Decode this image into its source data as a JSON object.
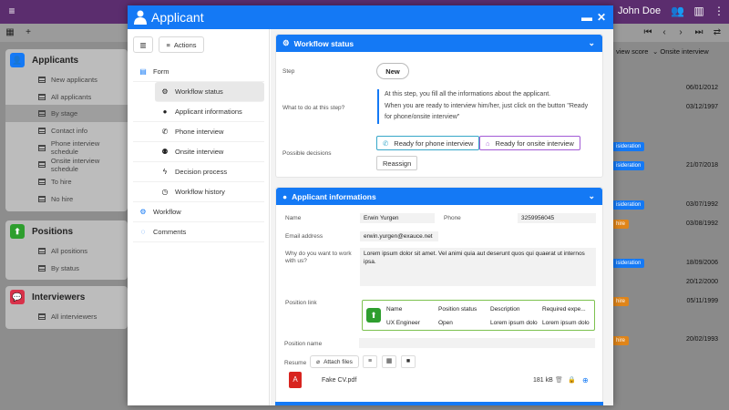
{
  "topbar": {
    "user_name": "John Doe"
  },
  "nav": {
    "applicants": {
      "title": "Applicants",
      "items": [
        "New applicants",
        "All applicants",
        "By stage",
        "Contact info",
        "Phone interview schedule",
        "Onsite interview schedule",
        "To hire",
        "No hire"
      ],
      "selected": "By stage"
    },
    "positions": {
      "title": "Positions",
      "items": [
        "All positions",
        "By status"
      ]
    },
    "interviewers": {
      "title": "Interviewers",
      "items": [
        "All interviewers"
      ]
    }
  },
  "background_list": {
    "columns": [
      "view score",
      "Onsite interview"
    ],
    "dates": [
      "06/01/2012",
      "03/12/1997",
      "21/07/2018",
      "03/07/1992",
      "03/08/1992",
      "18/09/2006",
      "20/12/2000",
      "05/11/1999",
      "20/02/1993"
    ],
    "badges": [
      "isideration",
      "isideration",
      "isideration",
      "hire",
      "isideration",
      "hire",
      "hire"
    ]
  },
  "modal": {
    "title": "Applicant",
    "actions_label": "Actions",
    "tree": [
      {
        "label": "Form",
        "icon": "form-icon",
        "level": 0
      },
      {
        "label": "Workflow status",
        "icon": "gear-icon",
        "level": 1,
        "selected": true
      },
      {
        "label": "Applicant informations",
        "icon": "user-icon",
        "level": 1
      },
      {
        "label": "Phone interview",
        "icon": "phone-icon",
        "level": 1
      },
      {
        "label": "Onsite interview",
        "icon": "users-icon",
        "level": 1
      },
      {
        "label": "Decision process",
        "icon": "bolt-icon",
        "level": 1
      },
      {
        "label": "Workflow history",
        "icon": "clock-icon",
        "level": 1
      },
      {
        "label": "Workflow",
        "icon": "workflow-icon",
        "level": 0
      },
      {
        "label": "Comments",
        "icon": "comment-icon",
        "level": 0
      }
    ],
    "workflow": {
      "title": "Workflow status",
      "step_label": "Step",
      "step_value": "New",
      "todo_label": "What to do at this step?",
      "todo_text_1": "At this step, you fill all the informations about the applicant.",
      "todo_text_2": "When you are ready to interview him/her, just click on the button \"Ready for phone/onsite interview\"",
      "decisions_label": "Possible decisions",
      "decisions": [
        "Ready for phone interview",
        "Ready for onsite interview",
        "Reassign"
      ]
    },
    "applicant": {
      "title": "Applicant informations",
      "name_label": "Name",
      "name_value": "Erwin Yurgen",
      "phone_label": "Phone",
      "phone_value": "3259956045",
      "email_label": "Email address",
      "email_value": "erwin.yurgen@exauce.net",
      "why_label": "Why do you want to work with us?",
      "why_value": "Lorem ipsum dolor sit amet. Vel animi quia aut deserunt quos qui quaerat ut internos ipsa.",
      "position_link_label": "Position link",
      "position_link": {
        "headers": [
          "Name",
          "Position status",
          "Description",
          "Required expe..."
        ],
        "row": [
          "UX Engineer",
          "Open",
          "Lorem ipsum dolo",
          "Lorem ipsum dolo"
        ]
      },
      "position_name_label": "Position name",
      "resume_label": "Resume",
      "attach_label": "Attach files",
      "file_name": "Fake CV.pdf",
      "file_size": "181 kB"
    }
  }
}
